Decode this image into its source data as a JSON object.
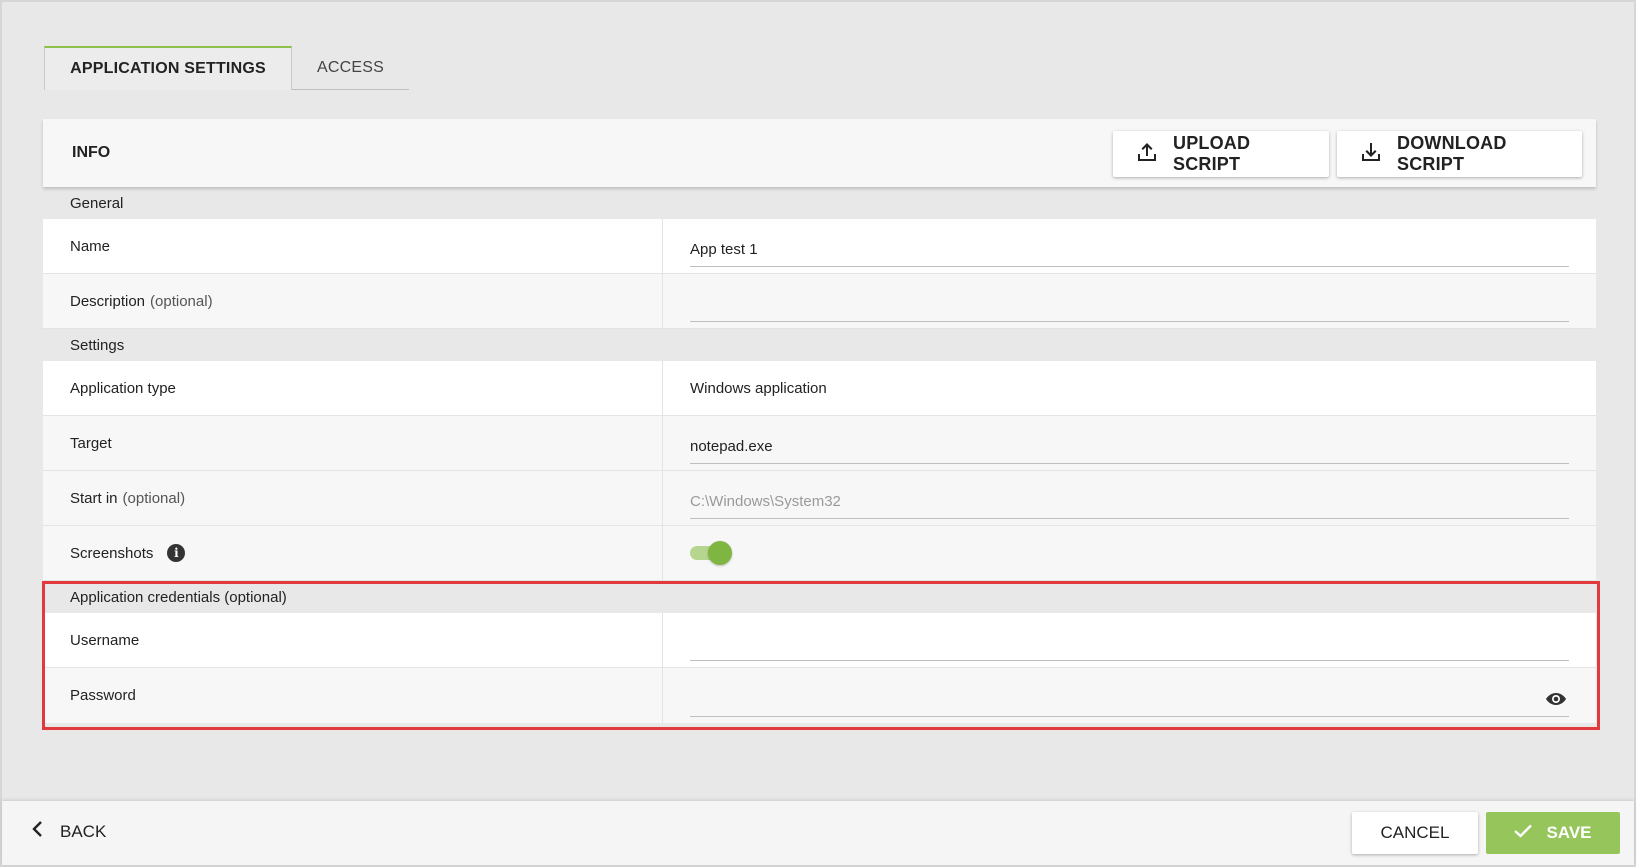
{
  "tabs": [
    {
      "label": "APPLICATION SETTINGS",
      "active": true
    },
    {
      "label": "ACCESS",
      "active": false
    }
  ],
  "panel": {
    "title": "INFO",
    "upload_label": "UPLOAD SCRIPT",
    "download_label": "DOWNLOAD SCRIPT",
    "upload_icon": "upload-icon",
    "download_icon": "download-icon"
  },
  "general": {
    "section_label": "General",
    "name_label": "Name",
    "name_value": "App test 1",
    "description_label": "Description",
    "description_optional": "(optional)",
    "description_value": ""
  },
  "settings": {
    "section_label": "Settings",
    "app_type_label": "Application type",
    "app_type_value": "Windows application",
    "target_label": "Target",
    "target_value": "notepad.exe",
    "start_in_label": "Start in",
    "start_in_optional": "(optional)",
    "start_in_placeholder": "C:\\Windows\\System32",
    "screenshots_label": "Screenshots",
    "screenshots_info_icon": "info-icon",
    "screenshots_enabled": true
  },
  "credentials": {
    "section_label": "Application credentials (optional)",
    "username_label": "Username",
    "username_value": "",
    "password_label": "Password",
    "password_value": "",
    "password_toggle_icon": "eye-icon"
  },
  "footer": {
    "back_label": "BACK",
    "cancel_label": "CANCEL",
    "save_label": "SAVE"
  },
  "colors": {
    "accent_green": "#8fc24f",
    "highlight_red": "#e0393e"
  }
}
